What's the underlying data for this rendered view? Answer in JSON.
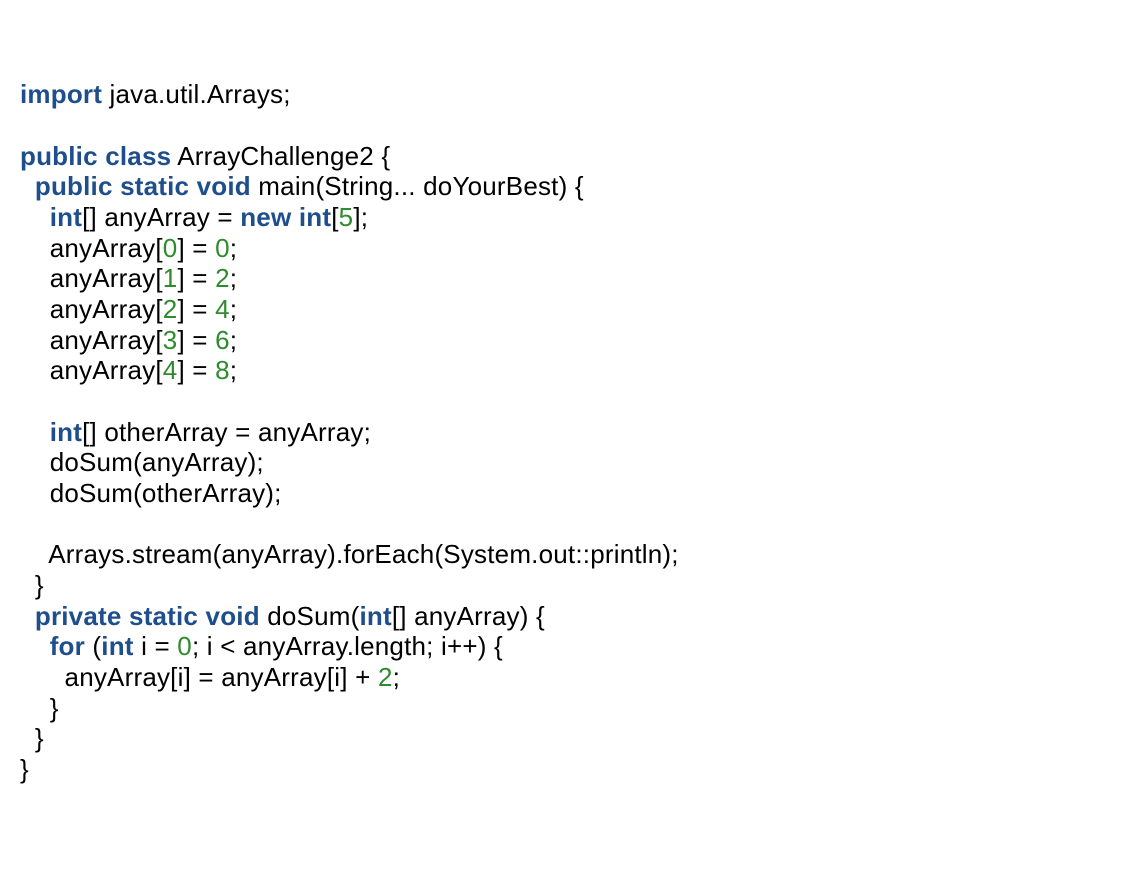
{
  "code": {
    "tokens": [
      {
        "c": "kw",
        "t": "import"
      },
      {
        "c": "plain",
        "t": " java.util.Arrays;\n\n"
      },
      {
        "c": "kw",
        "t": "public"
      },
      {
        "c": "plain",
        "t": " "
      },
      {
        "c": "kw",
        "t": "class"
      },
      {
        "c": "plain",
        "t": " ArrayChallenge2 {\n  "
      },
      {
        "c": "kw",
        "t": "public"
      },
      {
        "c": "plain",
        "t": " "
      },
      {
        "c": "kw",
        "t": "static"
      },
      {
        "c": "plain",
        "t": " "
      },
      {
        "c": "kw",
        "t": "void"
      },
      {
        "c": "plain",
        "t": " main(String... doYourBest) {\n    "
      },
      {
        "c": "kw",
        "t": "int"
      },
      {
        "c": "plain",
        "t": "[] anyArray = "
      },
      {
        "c": "kw",
        "t": "new"
      },
      {
        "c": "plain",
        "t": " "
      },
      {
        "c": "kw",
        "t": "int"
      },
      {
        "c": "plain",
        "t": "["
      },
      {
        "c": "num",
        "t": "5"
      },
      {
        "c": "plain",
        "t": "];\n    anyArray["
      },
      {
        "c": "num",
        "t": "0"
      },
      {
        "c": "plain",
        "t": "] = "
      },
      {
        "c": "num",
        "t": "0"
      },
      {
        "c": "plain",
        "t": ";\n    anyArray["
      },
      {
        "c": "num",
        "t": "1"
      },
      {
        "c": "plain",
        "t": "] = "
      },
      {
        "c": "num",
        "t": "2"
      },
      {
        "c": "plain",
        "t": ";\n    anyArray["
      },
      {
        "c": "num",
        "t": "2"
      },
      {
        "c": "plain",
        "t": "] = "
      },
      {
        "c": "num",
        "t": "4"
      },
      {
        "c": "plain",
        "t": ";\n    anyArray["
      },
      {
        "c": "num",
        "t": "3"
      },
      {
        "c": "plain",
        "t": "] = "
      },
      {
        "c": "num",
        "t": "6"
      },
      {
        "c": "plain",
        "t": ";\n    anyArray["
      },
      {
        "c": "num",
        "t": "4"
      },
      {
        "c": "plain",
        "t": "] = "
      },
      {
        "c": "num",
        "t": "8"
      },
      {
        "c": "plain",
        "t": ";\n\n    "
      },
      {
        "c": "kw",
        "t": "int"
      },
      {
        "c": "plain",
        "t": "[] otherArray = anyArray;\n    doSum(anyArray);\n    doSum(otherArray);\n\n    Arrays.stream(anyArray).forEach(System.out::println);\n  }\n  "
      },
      {
        "c": "kw",
        "t": "private"
      },
      {
        "c": "plain",
        "t": " "
      },
      {
        "c": "kw",
        "t": "static"
      },
      {
        "c": "plain",
        "t": " "
      },
      {
        "c": "kw",
        "t": "void"
      },
      {
        "c": "plain",
        "t": " doSum("
      },
      {
        "c": "kw",
        "t": "int"
      },
      {
        "c": "plain",
        "t": "[] anyArray) {\n    "
      },
      {
        "c": "kw",
        "t": "for"
      },
      {
        "c": "plain",
        "t": " ("
      },
      {
        "c": "kw",
        "t": "int"
      },
      {
        "c": "plain",
        "t": " i = "
      },
      {
        "c": "num",
        "t": "0"
      },
      {
        "c": "plain",
        "t": "; i < anyArray.length; i++) {\n      anyArray[i] = anyArray[i] + "
      },
      {
        "c": "num",
        "t": "2"
      },
      {
        "c": "plain",
        "t": ";\n    }\n  }\n}"
      }
    ]
  }
}
